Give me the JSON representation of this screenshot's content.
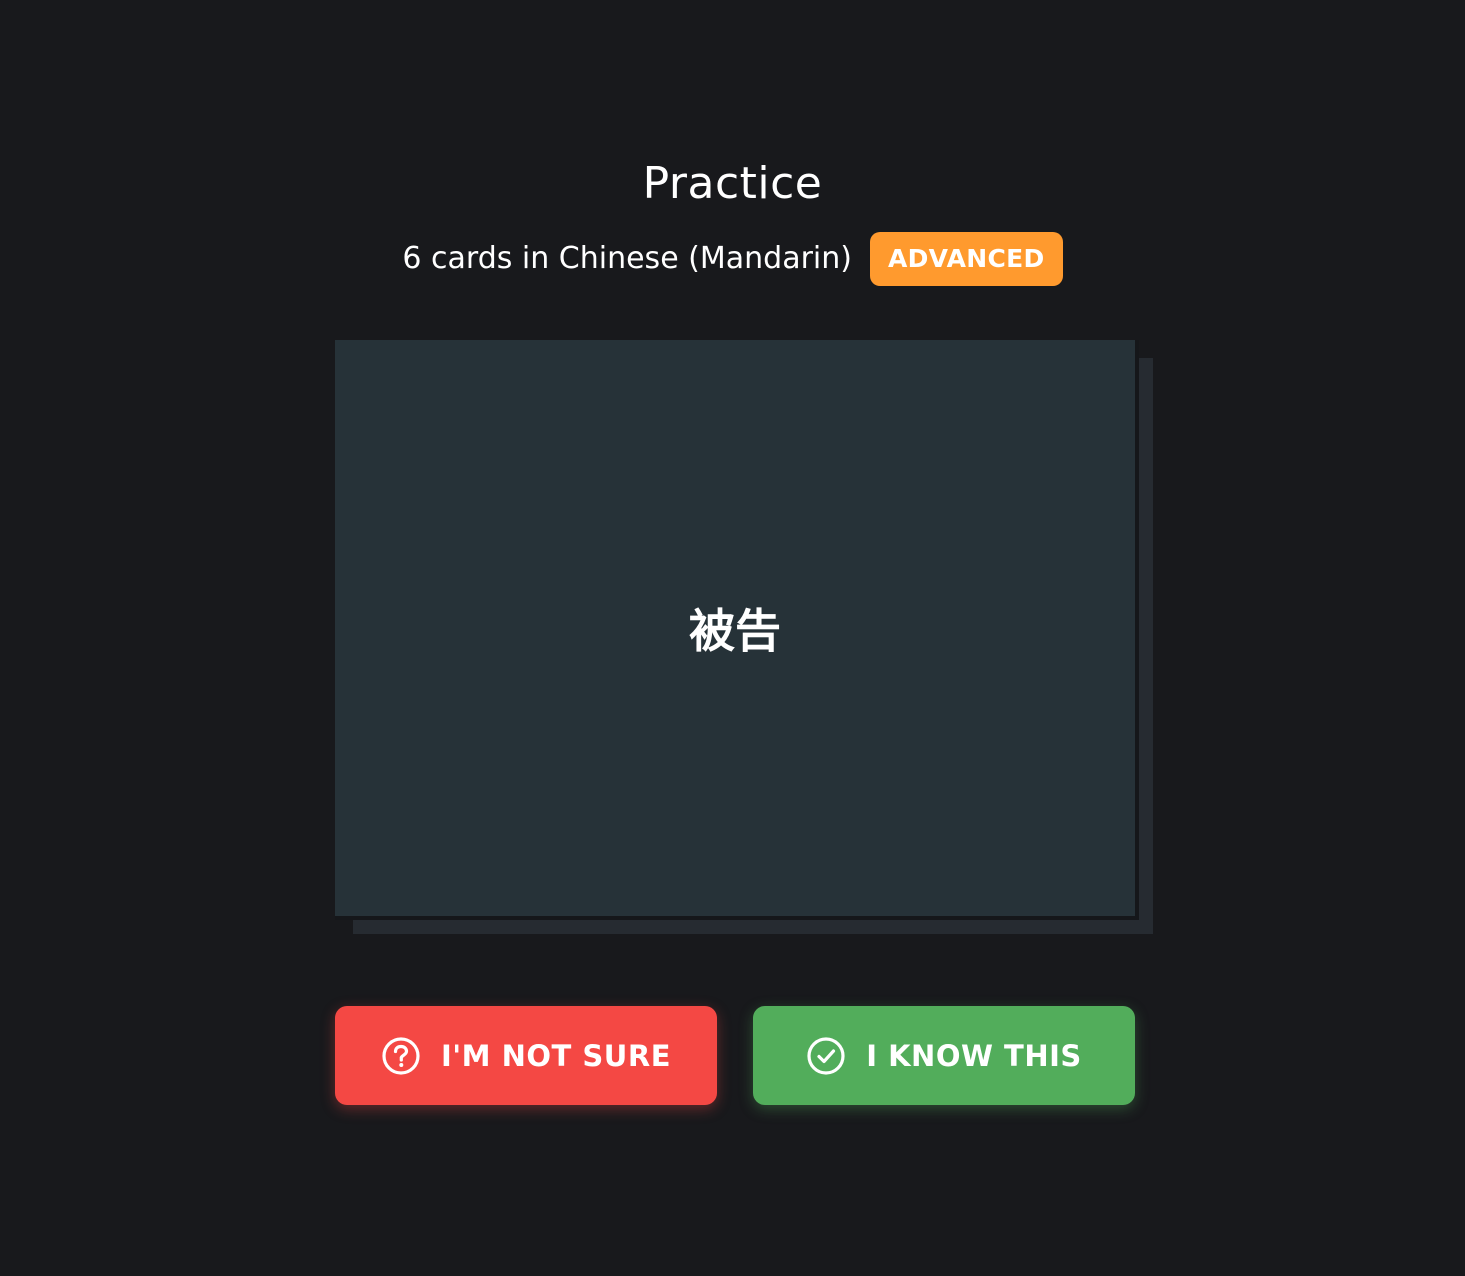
{
  "page": {
    "title": "Practice",
    "subtitle": "6 cards in Chinese (Mandarin)",
    "level_badge": "ADVANCED"
  },
  "card": {
    "term": "被告"
  },
  "actions": {
    "not_sure": {
      "label": "I'M NOT SURE",
      "icon": "question-circle-icon"
    },
    "know": {
      "label": "I KNOW THIS",
      "icon": "check-circle-icon"
    }
  },
  "colors": {
    "background": "#18191c",
    "card": "#263238",
    "badge": "#ff9a2e",
    "not_sure": "#f44844",
    "know": "#52ad5b"
  }
}
